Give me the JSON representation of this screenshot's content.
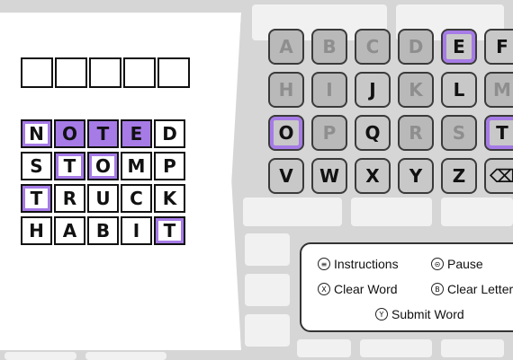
{
  "guesses": [
    [
      {
        "l": "N",
        "s": "present"
      },
      {
        "l": "O",
        "s": "correct"
      },
      {
        "l": "T",
        "s": "correct"
      },
      {
        "l": "E",
        "s": "correct"
      },
      {
        "l": "D",
        "s": "none"
      }
    ],
    [
      {
        "l": "S",
        "s": "none"
      },
      {
        "l": "T",
        "s": "present"
      },
      {
        "l": "O",
        "s": "present"
      },
      {
        "l": "M",
        "s": "none"
      },
      {
        "l": "P",
        "s": "none"
      }
    ],
    [
      {
        "l": "T",
        "s": "present"
      },
      {
        "l": "R",
        "s": "none"
      },
      {
        "l": "U",
        "s": "none"
      },
      {
        "l": "C",
        "s": "none"
      },
      {
        "l": "K",
        "s": "none"
      }
    ],
    [
      {
        "l": "H",
        "s": "none"
      },
      {
        "l": "A",
        "s": "none"
      },
      {
        "l": "B",
        "s": "none"
      },
      {
        "l": "I",
        "s": "none"
      },
      {
        "l": "T",
        "s": "present"
      }
    ]
  ],
  "keyboard": {
    "row1": [
      {
        "k": "A",
        "s": "gray"
      },
      {
        "k": "B",
        "s": "gray"
      },
      {
        "k": "C",
        "s": "gray"
      },
      {
        "k": "D",
        "s": "gray"
      },
      {
        "k": "E",
        "s": "present"
      },
      {
        "k": "F",
        "s": "avail"
      }
    ],
    "row2": [
      {
        "k": "H",
        "s": "gray"
      },
      {
        "k": "I",
        "s": "gray"
      },
      {
        "k": "J",
        "s": "avail"
      },
      {
        "k": "K",
        "s": "gray"
      },
      {
        "k": "L",
        "s": "avail"
      },
      {
        "k": "M",
        "s": "gray"
      }
    ],
    "row3": [
      {
        "k": "O",
        "s": "present"
      },
      {
        "k": "P",
        "s": "gray"
      },
      {
        "k": "Q",
        "s": "avail"
      },
      {
        "k": "R",
        "s": "gray"
      },
      {
        "k": "S",
        "s": "gray"
      },
      {
        "k": "T",
        "s": "present"
      }
    ],
    "row4": [
      {
        "k": "V",
        "s": "avail"
      },
      {
        "k": "W",
        "s": "avail"
      },
      {
        "k": "X",
        "s": "avail"
      },
      {
        "k": "Y",
        "s": "avail"
      },
      {
        "k": "Z",
        "s": "avail"
      },
      {
        "k": "⌫",
        "s": "avail"
      }
    ]
  },
  "controls": {
    "instructions": {
      "glyph": "≡",
      "label": "Instructions"
    },
    "pause": {
      "glyph": "⊝",
      "label": "Pause"
    },
    "clear_word": {
      "glyph": "X",
      "label": "Clear Word"
    },
    "clear_letter": {
      "glyph": "B",
      "label": "Clear Letter"
    },
    "submit_word": {
      "glyph": "Y",
      "label": "Submit Word"
    }
  },
  "colors": {
    "accent": "#a67be6",
    "key_bg": "#c8c8c8",
    "key_used": "#b9b9b9"
  }
}
